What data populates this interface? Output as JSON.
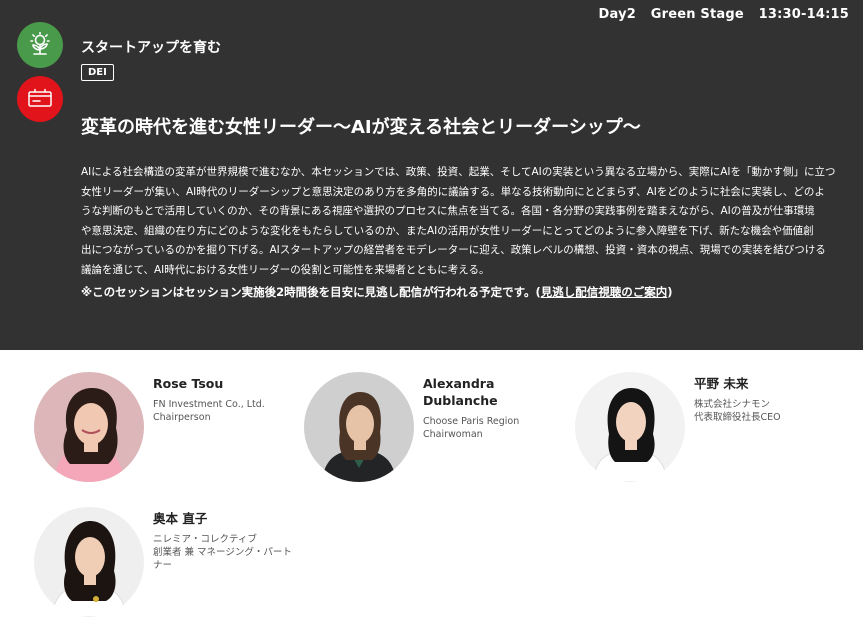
{
  "schedule": {
    "day": "Day2",
    "stage": "Green Stage",
    "time": "13:30-14:15"
  },
  "category_icons": [
    {
      "name": "sprout-bulb-icon",
      "color": "#4a9a4b"
    },
    {
      "name": "card-icon",
      "color": "#e0141a"
    }
  ],
  "track": "スタートアップを育む",
  "tag": "DEI",
  "title": "変革の時代を進む女性リーダー〜AIが変える社会とリーダーシップ〜",
  "description": [
    "AIによる社会構造の変革が世界規模で進むなか、本セッションでは、政策、投資、起業、そしてAIの実装という異なる立場から、実際にAIを「動かす側」に立つ",
    "女性リーダーが集い、AI時代のリーダーシップと意思決定のあり方を多角的に議論する。単なる技術動向にとどまらず、AIをどのように社会に実装し、どのよ",
    "うな判断のもとで活用していくのか、その背景にある視座や選択のプロセスに焦点を当てる。各国・各分野の実践事例を踏まえながら、AIの普及が仕事環境",
    "や意思決定、組織の在り方にどのような変化をもたらしているのか、またAIの活用が女性リーダーにとってどのように参入障壁を下げ、新たな機会や価値創",
    "出につながっているのかを掘り下げる。AIスタートアップの経営者をモデレーターに迎え、政策レベルの構想、投資・資本の視点、現場での実装を結びつける",
    "議論を通じて、AI時代における女性リーダーの役割と可能性を来場者とともに考える。"
  ],
  "note": {
    "prefix": "※このセッションはセッション実施後2時間後を目安に見逃し配信が行われる予定です。(",
    "link": "見逃し配信視聴のご案内",
    "suffix": ")"
  },
  "speakers": [
    {
      "name": "Rose Tsou",
      "lines": [
        "FN Investment Co., Ltd.",
        "Chairperson"
      ]
    },
    {
      "name": "Alexandra Dublanche",
      "lines": [
        "Choose Paris Region",
        "Chairwoman"
      ]
    },
    {
      "name": "平野 未来",
      "lines": [
        "株式会社シナモン",
        "代表取締役社長CEO"
      ]
    },
    {
      "name": "奥本 直子",
      "lines": [
        "ニレミア・コレクティブ",
        "創業者 兼 マネージング・パート",
        "ナー"
      ]
    }
  ]
}
